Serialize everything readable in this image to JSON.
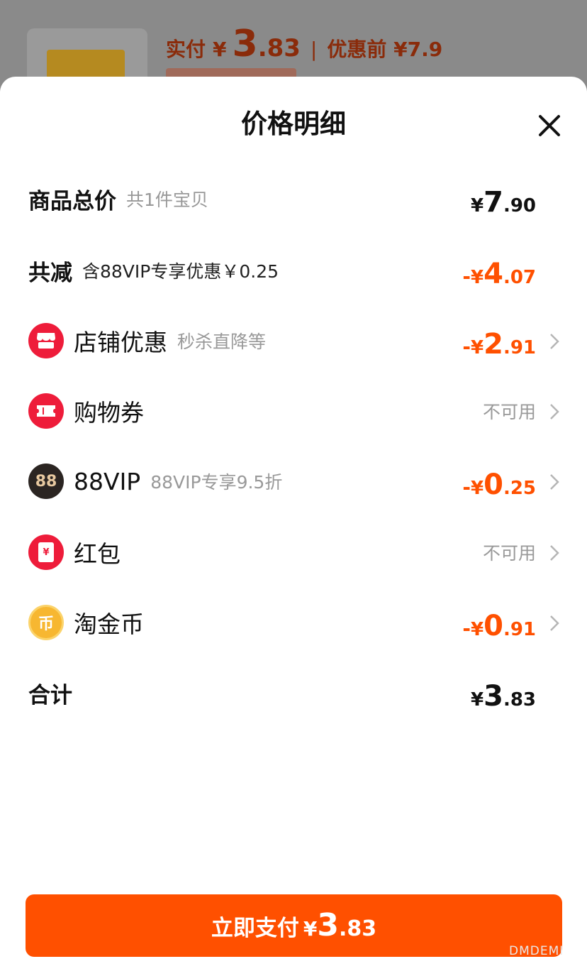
{
  "background": {
    "paid_label": "实付",
    "yen": "¥",
    "paid_int": "3",
    "paid_dec": ".83",
    "separator": "|",
    "before_discount": "优惠前 ¥7.9"
  },
  "sheet": {
    "title": "价格明细",
    "close_icon": "close-icon"
  },
  "rows": {
    "total": {
      "label": "商品总价",
      "sub": "共1件宝贝",
      "yen": "¥",
      "int": "7",
      "dec": ".90"
    },
    "reduction": {
      "label": "共减",
      "sub": "含88VIP专享优惠￥0.25",
      "sign": "-",
      "yen": "¥",
      "int": "4",
      "dec": ".07"
    },
    "store": {
      "label": "店铺优惠",
      "sub": "秒杀直降等",
      "sign": "-",
      "yen": "¥",
      "int": "2",
      "dec": ".91",
      "icon": "store-icon"
    },
    "coupon": {
      "label": "购物券",
      "status": "不可用",
      "icon": "ticket-icon"
    },
    "vip": {
      "label": "88VIP",
      "sub": "88VIP专享9.5折",
      "sign": "-",
      "yen": "¥",
      "int": "0",
      "dec": ".25",
      "icon_text": "88"
    },
    "redpacket": {
      "label": "红包",
      "status": "不可用",
      "icon_text": "¥"
    },
    "coins": {
      "label": "淘金币",
      "sign": "-",
      "yen": "¥",
      "int": "0",
      "dec": ".91",
      "icon_text": "币"
    },
    "sum": {
      "label": "合计",
      "yen": "¥",
      "int": "3",
      "dec": ".83"
    }
  },
  "pay_button": {
    "label": "立即支付",
    "yen": "¥",
    "int": "3",
    "dec": ".83"
  },
  "watermark": "DMDEMI",
  "colors": {
    "accent": "#ff5000",
    "red_icon": "#ee1c3a",
    "vip_icon": "#2b2522",
    "coin_icon": "#f7b731"
  }
}
